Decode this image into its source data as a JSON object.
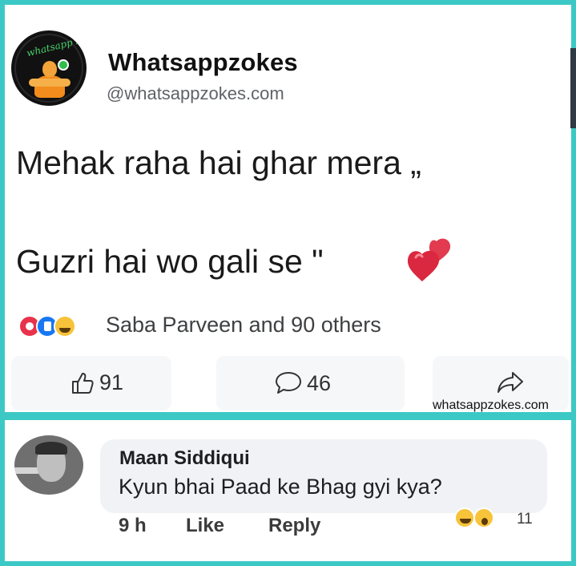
{
  "account": {
    "name": "Whatsappzokes",
    "handle": "@whatsappzokes.com",
    "avatar_icon": "cartoon-figure-logo-icon"
  },
  "post": {
    "lines": [
      "Mehak raha hai ghar mera „",
      "Guzri hai wo gali se \""
    ],
    "emoji_icon": "two-hearts-icon"
  },
  "reactions": {
    "icons": [
      "love-reaction-icon",
      "like-reaction-icon",
      "haha-reaction-icon"
    ],
    "summary": "Saba Parveen and 90 others"
  },
  "actions": {
    "like_count": "91",
    "comment_count": "46",
    "share_icon": "share-arrow-icon"
  },
  "watermark": "whatsappzokes.com",
  "comment": {
    "author": "Maan Siddiqui",
    "text": "Kyun bhai Paad ke Bhag gyi kya?",
    "time": "9 h",
    "like_label": "Like",
    "reply_label": "Reply",
    "reaction_count": "11",
    "reaction_icons": [
      "haha-reaction-icon",
      "wow-reaction-icon"
    ]
  },
  "colors": {
    "frame": "#3cc9c6",
    "like_blue": "#1877f2",
    "love_red": "#e8334a",
    "haha_yellow": "#f7c33a"
  }
}
